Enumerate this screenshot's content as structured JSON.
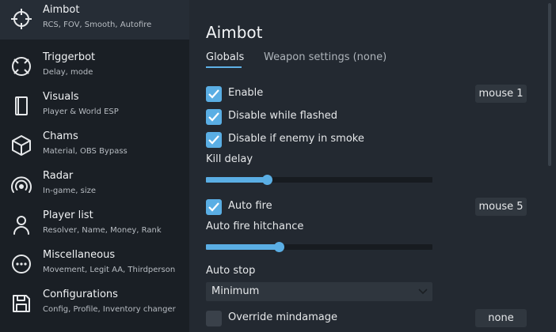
{
  "sidebar": {
    "items": [
      {
        "title": "Aimbot",
        "subtitle": "RCS, FOV, Smooth, Autofire",
        "icon": "crosshair-icon"
      },
      {
        "title": "Triggerbot",
        "subtitle": "Delay, mode",
        "icon": "target-icon"
      },
      {
        "title": "Visuals",
        "subtitle": "Player & World ESP",
        "icon": "box-icon"
      },
      {
        "title": "Chams",
        "subtitle": "Material, OBS Bypass",
        "icon": "cube-icon"
      },
      {
        "title": "Radar",
        "subtitle": "In-game, size",
        "icon": "radar-icon"
      },
      {
        "title": "Player list",
        "subtitle": "Resolver, Name, Money, Rank",
        "icon": "person-icon"
      },
      {
        "title": "Miscellaneous",
        "subtitle": "Movement, Legit AA, Thirdperson",
        "icon": "more-icon"
      },
      {
        "title": "Configurations",
        "subtitle": "Config, Profile, Inventory changer",
        "icon": "save-icon"
      }
    ],
    "active_index": 0
  },
  "main": {
    "title": "Aimbot",
    "tabs": [
      {
        "label": "Globals",
        "active": true
      },
      {
        "label": "Weapon settings (none)",
        "active": false
      }
    ],
    "options": {
      "enable": {
        "label": "Enable",
        "checked": true,
        "key": "mouse 1"
      },
      "disable_flashed": {
        "label": "Disable while flashed",
        "checked": true
      },
      "disable_smoke": {
        "label": "Disable if enemy in smoke",
        "checked": true
      },
      "kill_delay": {
        "label": "Kill delay",
        "value_fraction": 0.27
      },
      "auto_fire": {
        "label": "Auto fire",
        "checked": true,
        "key": "mouse 5"
      },
      "auto_fire_hitchance": {
        "label": "Auto fire hitchance",
        "value_fraction": 0.32
      },
      "auto_stop": {
        "label": "Auto stop",
        "value": "Minimum"
      },
      "override_mindamage": {
        "label": "Override mindamage",
        "checked": false,
        "key": "none"
      }
    }
  },
  "colors": {
    "accent": "#5aaee4",
    "sidebar_bg": "#1a1f25",
    "main_bg": "#232931"
  }
}
